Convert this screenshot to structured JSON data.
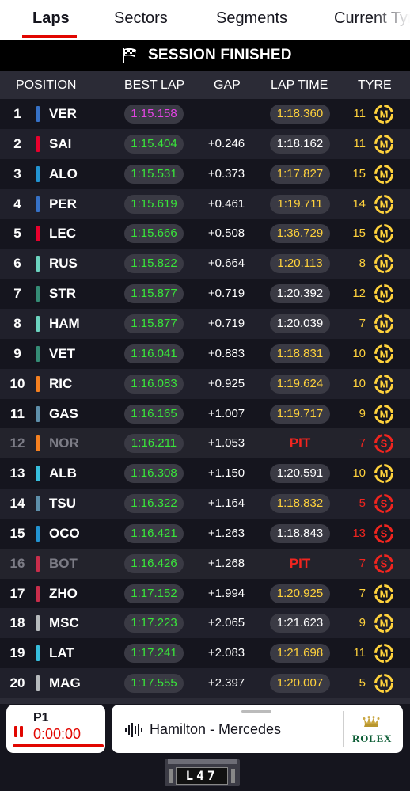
{
  "tabs": [
    {
      "label": "Laps",
      "active": true
    },
    {
      "label": "Sectors",
      "active": false
    },
    {
      "label": "Segments",
      "active": false
    },
    {
      "label": "Current Tyre",
      "active": false
    }
  ],
  "banner": {
    "text": "SESSION FINISHED",
    "icon": "chequered-flag-icon"
  },
  "columns": {
    "position": "POSITION",
    "best_lap": "BEST LAP",
    "gap": "GAP",
    "lap_time": "LAP TIME",
    "tyre": "TYRE"
  },
  "colors": {
    "accent": "#e10600",
    "personal_best": "#39e53a",
    "fastest": "#e543e5",
    "lap_yellow": "#ffd23c",
    "pit_red": "#f0251f"
  },
  "rows": [
    {
      "pos": "1",
      "code": "VER",
      "team_color": "#3671c6",
      "best": "1:15.158",
      "best_fastest": true,
      "gap": "",
      "lap": "1:18.360",
      "lap_yellow": true,
      "pit": false,
      "laps": "11",
      "tyre": "M"
    },
    {
      "pos": "2",
      "code": "SAI",
      "team_color": "#e8002d",
      "best": "1:15.404",
      "best_fastest": false,
      "gap": "+0.246",
      "lap": "1:18.162",
      "lap_yellow": false,
      "pit": false,
      "laps": "11",
      "tyre": "M"
    },
    {
      "pos": "3",
      "code": "ALO",
      "team_color": "#2293d1",
      "best": "1:15.531",
      "best_fastest": false,
      "gap": "+0.373",
      "lap": "1:17.827",
      "lap_yellow": true,
      "pit": false,
      "laps": "15",
      "tyre": "M"
    },
    {
      "pos": "4",
      "code": "PER",
      "team_color": "#3671c6",
      "best": "1:15.619",
      "best_fastest": false,
      "gap": "+0.461",
      "lap": "1:19.711",
      "lap_yellow": true,
      "pit": false,
      "laps": "14",
      "tyre": "M"
    },
    {
      "pos": "5",
      "code": "LEC",
      "team_color": "#e8002d",
      "best": "1:15.666",
      "best_fastest": false,
      "gap": "+0.508",
      "lap": "1:36.729",
      "lap_yellow": true,
      "pit": false,
      "laps": "15",
      "tyre": "M"
    },
    {
      "pos": "6",
      "code": "RUS",
      "team_color": "#6cd3bf",
      "best": "1:15.822",
      "best_fastest": false,
      "gap": "+0.664",
      "lap": "1:20.113",
      "lap_yellow": true,
      "pit": false,
      "laps": "8",
      "tyre": "M"
    },
    {
      "pos": "7",
      "code": "STR",
      "team_color": "#358c75",
      "best": "1:15.877",
      "best_fastest": false,
      "gap": "+0.719",
      "lap": "1:20.392",
      "lap_yellow": false,
      "pit": false,
      "laps": "12",
      "tyre": "M"
    },
    {
      "pos": "8",
      "code": "HAM",
      "team_color": "#6cd3bf",
      "best": "1:15.877",
      "best_fastest": false,
      "gap": "+0.719",
      "lap": "1:20.039",
      "lap_yellow": false,
      "pit": false,
      "laps": "7",
      "tyre": "M"
    },
    {
      "pos": "9",
      "code": "VET",
      "team_color": "#358c75",
      "best": "1:16.041",
      "best_fastest": false,
      "gap": "+0.883",
      "lap": "1:18.831",
      "lap_yellow": true,
      "pit": false,
      "laps": "10",
      "tyre": "M"
    },
    {
      "pos": "10",
      "code": "RIC",
      "team_color": "#f58020",
      "best": "1:16.083",
      "best_fastest": false,
      "gap": "+0.925",
      "lap": "1:19.624",
      "lap_yellow": true,
      "pit": false,
      "laps": "10",
      "tyre": "M"
    },
    {
      "pos": "11",
      "code": "GAS",
      "team_color": "#5e8faa",
      "best": "1:16.165",
      "best_fastest": false,
      "gap": "+1.007",
      "lap": "1:19.717",
      "lap_yellow": true,
      "pit": false,
      "laps": "9",
      "tyre": "M"
    },
    {
      "pos": "12",
      "code": "NOR",
      "team_color": "#f58020",
      "best": "1:16.211",
      "best_fastest": false,
      "gap": "+1.053",
      "lap": "PIT",
      "lap_yellow": false,
      "pit": true,
      "laps": "7",
      "tyre": "S"
    },
    {
      "pos": "13",
      "code": "ALB",
      "team_color": "#37bedd",
      "best": "1:16.308",
      "best_fastest": false,
      "gap": "+1.150",
      "lap": "1:20.591",
      "lap_yellow": false,
      "pit": false,
      "laps": "10",
      "tyre": "M"
    },
    {
      "pos": "14",
      "code": "TSU",
      "team_color": "#5e8faa",
      "best": "1:16.322",
      "best_fastest": false,
      "gap": "+1.164",
      "lap": "1:18.832",
      "lap_yellow": true,
      "pit": false,
      "laps": "5",
      "tyre": "S"
    },
    {
      "pos": "15",
      "code": "OCO",
      "team_color": "#2293d1",
      "best": "1:16.421",
      "best_fastest": false,
      "gap": "+1.263",
      "lap": "1:18.843",
      "lap_yellow": false,
      "pit": false,
      "laps": "13",
      "tyre": "S"
    },
    {
      "pos": "16",
      "code": "BOT",
      "team_color": "#c92d4b",
      "best": "1:16.426",
      "best_fastest": false,
      "gap": "+1.268",
      "lap": "PIT",
      "lap_yellow": false,
      "pit": true,
      "laps": "7",
      "tyre": "S"
    },
    {
      "pos": "17",
      "code": "ZHO",
      "team_color": "#c92d4b",
      "best": "1:17.152",
      "best_fastest": false,
      "gap": "+1.994",
      "lap": "1:20.925",
      "lap_yellow": true,
      "pit": false,
      "laps": "7",
      "tyre": "M"
    },
    {
      "pos": "18",
      "code": "MSC",
      "team_color": "#b6babd",
      "best": "1:17.223",
      "best_fastest": false,
      "gap": "+2.065",
      "lap": "1:21.623",
      "lap_yellow": false,
      "pit": false,
      "laps": "9",
      "tyre": "M"
    },
    {
      "pos": "19",
      "code": "LAT",
      "team_color": "#37bedd",
      "best": "1:17.241",
      "best_fastest": false,
      "gap": "+2.083",
      "lap": "1:21.698",
      "lap_yellow": true,
      "pit": false,
      "laps": "11",
      "tyre": "M"
    },
    {
      "pos": "20",
      "code": "MAG",
      "team_color": "#b6babd",
      "best": "1:17.555",
      "best_fastest": false,
      "gap": "+2.397",
      "lap": "1:20.007",
      "lap_yellow": true,
      "pit": false,
      "laps": "5",
      "tyre": "M"
    }
  ],
  "player": {
    "label": "P1",
    "time": "0:00:00",
    "progress": 1.0
  },
  "audio": {
    "name": "Hamilton - Mercedes",
    "sponsor": "ROLEX",
    "icon": "audio-waveform-icon"
  },
  "lap_board": "L47"
}
